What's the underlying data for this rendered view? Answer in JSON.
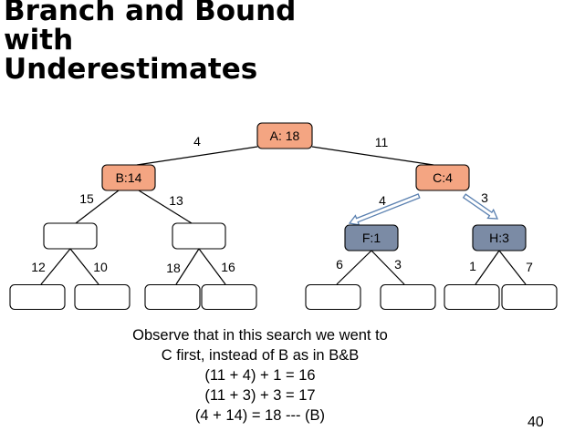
{
  "slide": {
    "title_lines": [
      "Branch and Bound",
      "with",
      "Underestimates"
    ],
    "caption_lines": [
      "Observe that in this search we went to",
      "C first, instead of B as in B&B",
      "(11 + 4) + 1 = 16",
      "(11 + 3) + 3 = 17",
      "(4 + 14) = 18 --- (B)"
    ],
    "page_number": "40"
  },
  "tree": {
    "colors": {
      "orange": "#f4a582",
      "blue_gray": "#7b8ba5",
      "empty": "#ffffff"
    },
    "nodes": [
      {
        "id": "A",
        "label": "A: 18",
        "color": "orange"
      },
      {
        "id": "B",
        "label": "B:14",
        "color": "orange"
      },
      {
        "id": "C",
        "label": "C:4",
        "color": "orange"
      },
      {
        "id": "B1",
        "label": "",
        "color": "empty"
      },
      {
        "id": "B2",
        "label": "",
        "color": "empty"
      },
      {
        "id": "F",
        "label": "F:1",
        "color": "blue_gray"
      },
      {
        "id": "H",
        "label": "H:3",
        "color": "blue_gray"
      },
      {
        "id": "L1",
        "label": "",
        "color": "empty"
      },
      {
        "id": "L2",
        "label": "",
        "color": "empty"
      },
      {
        "id": "L3",
        "label": "",
        "color": "empty"
      },
      {
        "id": "L4",
        "label": "",
        "color": "empty"
      },
      {
        "id": "L5",
        "label": "",
        "color": "empty"
      },
      {
        "id": "L6",
        "label": "",
        "color": "empty"
      },
      {
        "id": "L7",
        "label": "",
        "color": "empty"
      },
      {
        "id": "L8",
        "label": "",
        "color": "empty"
      }
    ],
    "edges": [
      {
        "from": "A",
        "to": "B",
        "cost": "4",
        "style": "line"
      },
      {
        "from": "A",
        "to": "C",
        "cost": "11",
        "style": "line"
      },
      {
        "from": "B",
        "to": "B1",
        "cost": "15",
        "style": "line"
      },
      {
        "from": "B",
        "to": "B2",
        "cost": "13",
        "style": "line"
      },
      {
        "from": "C",
        "to": "F",
        "cost": "4",
        "style": "arrow"
      },
      {
        "from": "C",
        "to": "H",
        "cost": "3",
        "style": "arrow"
      },
      {
        "from": "B1",
        "to": "L1",
        "cost": "12",
        "style": "line"
      },
      {
        "from": "B1",
        "to": "L2",
        "cost": "10",
        "style": "line"
      },
      {
        "from": "B2",
        "to": "L3",
        "cost": "18",
        "style": "line"
      },
      {
        "from": "B2",
        "to": "L4",
        "cost": "16",
        "style": "line"
      },
      {
        "from": "F",
        "to": "L5",
        "cost": "6",
        "style": "line"
      },
      {
        "from": "F",
        "to": "L6",
        "cost": "3",
        "style": "line"
      },
      {
        "from": "H",
        "to": "L7",
        "cost": "1",
        "style": "line"
      },
      {
        "from": "H",
        "to": "L8",
        "cost": "7",
        "style": "line"
      }
    ]
  }
}
